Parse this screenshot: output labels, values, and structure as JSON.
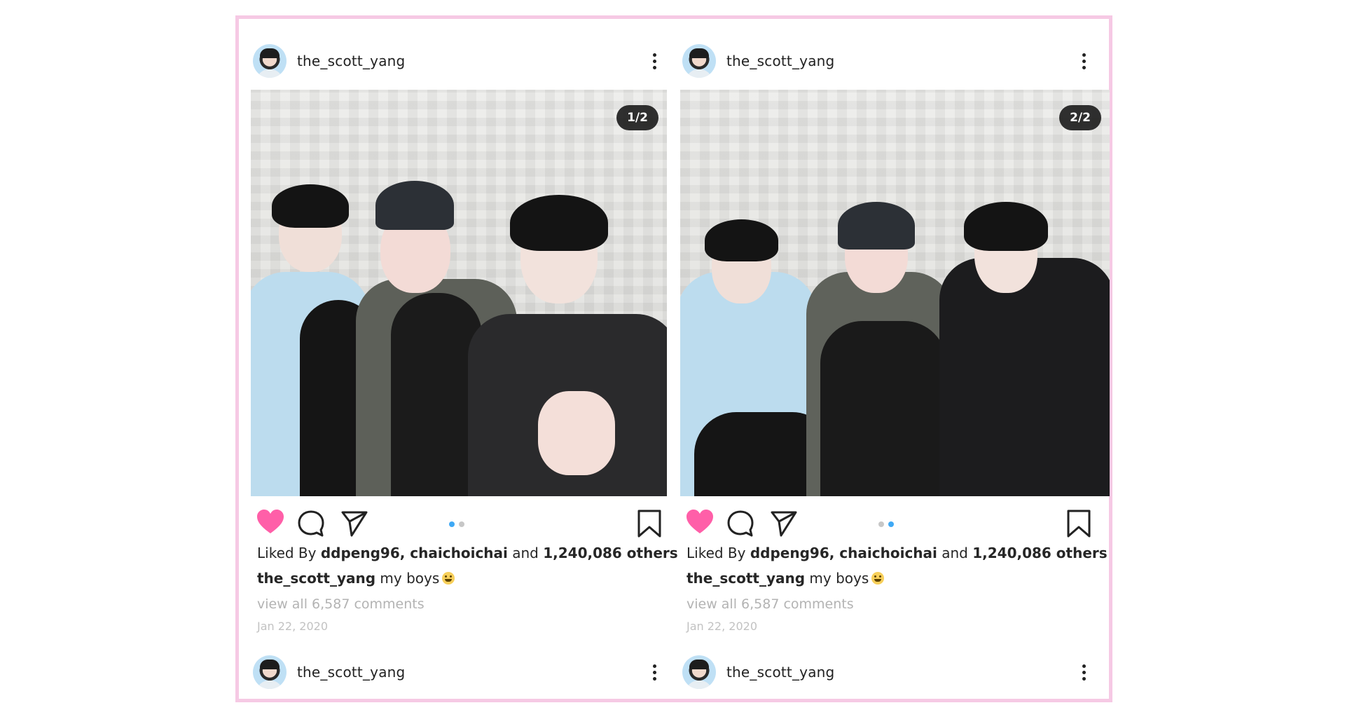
{
  "posts": [
    {
      "username": "the_scott_yang",
      "counter": "1/2",
      "liked_prefix": "Liked By ",
      "liked_users": "ddpeng96, chaichoichai",
      "liked_and": " and ",
      "liked_others": "1,240,086 others",
      "caption_user": "the_scott_yang",
      "caption_text": " my boys",
      "comments": "view all 6,587 comments",
      "date": "Jan 22, 2020",
      "active_dot": 0,
      "next_username": "the_scott_yang"
    },
    {
      "username": "the_scott_yang",
      "counter": "2/2",
      "liked_prefix": "Liked By ",
      "liked_users": "ddpeng96, chaichoichai",
      "liked_and": " and ",
      "liked_others": "1,240,086 others",
      "caption_user": "the_scott_yang",
      "caption_text": " my boys",
      "comments": "view all 6,587 comments",
      "date": "Jan 22, 2020",
      "active_dot": 1,
      "next_username": "the_scott_yang"
    }
  ],
  "icons": {
    "like": "heart-icon",
    "comment": "comment-icon",
    "share": "send-icon",
    "save": "bookmark-icon",
    "more": "more-vertical-icon",
    "emoji": "grinning-face-emoji"
  },
  "colors": {
    "frame_border": "#f6c9e4",
    "heart": "#ff5fa8",
    "dot_active": "#3fa9f5",
    "dot_inactive": "#c7c7c7",
    "text_muted": "#b3b3b3"
  }
}
